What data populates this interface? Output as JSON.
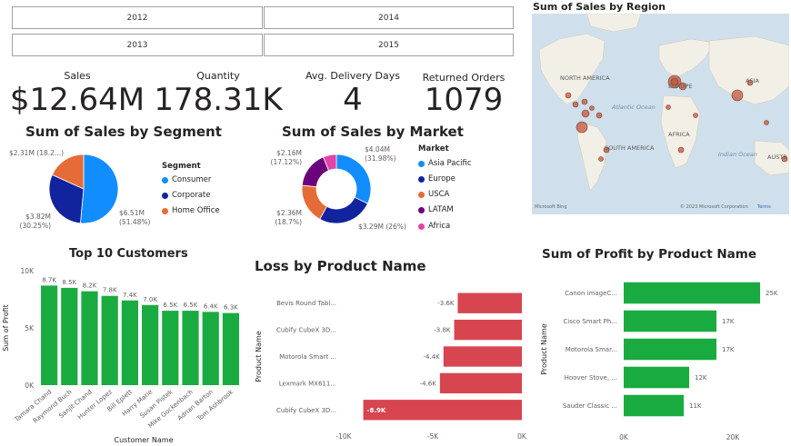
{
  "slicer": {
    "years": [
      "2012",
      "2014",
      "2013",
      "2015"
    ]
  },
  "kpis": [
    {
      "label": "Sales",
      "value": "$12.64M"
    },
    {
      "label": "Quantity",
      "value": "178.31K"
    },
    {
      "label": "Avg. Delivery Days",
      "value": "4"
    },
    {
      "label": "Returned Orders",
      "value": "1079"
    }
  ],
  "map": {
    "title": "Sum of Sales by Region",
    "labels": [
      "NORTH AMERICA",
      "EUROPE",
      "ASIA",
      "Atlantic Ocean",
      "AFRICA",
      "SOUTH AMERICA",
      "Indian Ocean",
      "AUSTR"
    ],
    "footer_left": "Microsoft Bing",
    "footer_right": "© 2023 Microsoft Corporation",
    "footer_terms": "Terms"
  },
  "colors": {
    "consumer": "#118DFF",
    "corporate": "#12239E",
    "home_office": "#E66C37",
    "latam": "#6B007B",
    "africa": "#E044A7",
    "bar_green": "#1AAB40",
    "loss_red": "#D64550"
  },
  "chart_data": [
    {
      "type": "pie",
      "title": "Sum of Sales by Segment",
      "legend_title": "Segment",
      "legend_position": "right",
      "categories": [
        "Consumer",
        "Corporate",
        "Home Office"
      ],
      "values": [
        6.51,
        3.82,
        2.31
      ],
      "percents": [
        51.48,
        30.25,
        18.27
      ],
      "data_labels": [
        "$6.51M (51.48%)",
        "$3.82M (30.25%)",
        "$2.31M (18.2...)"
      ]
    },
    {
      "type": "pie",
      "donut": true,
      "title": "Sum of Sales by Market",
      "legend_title": "Market",
      "legend_position": "right",
      "categories": [
        "Asia Pacific",
        "Europe",
        "USCA",
        "LATAM",
        "Africa"
      ],
      "values": [
        4.04,
        3.29,
        2.36,
        2.16,
        0.79
      ],
      "percents": [
        31.98,
        26,
        18.7,
        17.12,
        6.2
      ],
      "data_labels": [
        "$4.04M (31.98%)",
        "$3.29M (26%)",
        "$2.36M (18.7%)",
        "$2.16M (17.12%)",
        ""
      ]
    },
    {
      "type": "bar",
      "title": "Top 10 Customers",
      "xlabel": "Customer Name",
      "ylabel": "Sum of Profit",
      "ylim": [
        0,
        10000
      ],
      "yticks": [
        0,
        5000,
        10000
      ],
      "ytick_labels": [
        "0K",
        "5K",
        "10K"
      ],
      "grid": false,
      "categories": [
        "Tamara Chand",
        "Raymond Buch",
        "Sanjit Chand",
        "Hunter Lopez",
        "Bill Eplett",
        "Harry Marie",
        "Susan Pistek",
        "Mike Gockenbach",
        "Adrian Barton",
        "Tom Ashbrook"
      ],
      "values": [
        8700,
        8500,
        8200,
        7800,
        7400,
        7000,
        6500,
        6500,
        6400,
        6300
      ],
      "data_labels": [
        "8.7K",
        "8.5K",
        "8.2K",
        "7.8K",
        "7.4K",
        "7.0K",
        "6.5K",
        "6.5K",
        "6.4K",
        "6.3K"
      ]
    },
    {
      "type": "bar",
      "orientation": "horizontal",
      "title": "Loss by Product Name",
      "xlabel": "",
      "ylabel": "Product Name",
      "xlim": [
        -10000,
        0
      ],
      "xticks": [
        -10000,
        -5000,
        0
      ],
      "xtick_labels": [
        "-10K",
        "-5K",
        "0K"
      ],
      "categories": [
        "Bevis Round Tabl...",
        "Cubify CubeX 3D...",
        "Motorola Smart ...",
        "Lexmark MX611...",
        "Cubify CubeX 3D..."
      ],
      "values": [
        -3600,
        -3800,
        -4400,
        -4600,
        -8900
      ],
      "data_labels": [
        "-3.6K",
        "-3.8K",
        "-4.4K",
        "-4.6K",
        "-8.9K"
      ]
    },
    {
      "type": "bar",
      "orientation": "horizontal",
      "title": "Sum of Profit by Product Name",
      "xlabel": "",
      "ylabel": "Product Name",
      "xlim": [
        0,
        26000
      ],
      "xticks": [
        0,
        20000
      ],
      "xtick_labels": [
        "0K",
        "20K"
      ],
      "categories": [
        "Canon imageC...",
        "Cisco Smart Ph...",
        "Motorola Smar...",
        "Hoover Stove, ...",
        "Sauder Classic ..."
      ],
      "values": [
        25000,
        17000,
        17000,
        12000,
        11000
      ],
      "data_labels": [
        "25K",
        "17K",
        "17K",
        "12K",
        "11K"
      ]
    }
  ]
}
